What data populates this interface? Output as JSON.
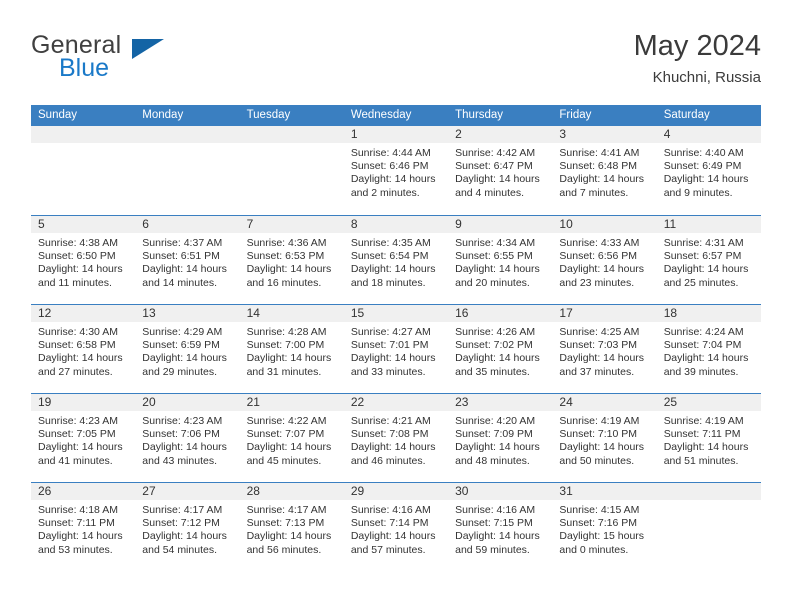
{
  "brand": {
    "line1": "General",
    "line2": "Blue",
    "triangle_color": "#1464a5",
    "blue_color": "#1a79c8"
  },
  "header": {
    "title": "May 2024",
    "subtitle": "Khuchni, Russia"
  },
  "theme": {
    "header_bg": "#3a7fc1",
    "header_text": "#ffffff",
    "daynum_bg": "#f0f0f0",
    "cell_bg": "#ffffff",
    "text": "#333333"
  },
  "weekdays": [
    "Sunday",
    "Monday",
    "Tuesday",
    "Wednesday",
    "Thursday",
    "Friday",
    "Saturday"
  ],
  "weeks": [
    [
      {
        "day": ""
      },
      {
        "day": ""
      },
      {
        "day": ""
      },
      {
        "day": "1",
        "sunrise": "Sunrise: 4:44 AM",
        "sunset": "Sunset: 6:46 PM",
        "daylight_1": "Daylight: 14 hours",
        "daylight_2": "and 2 minutes."
      },
      {
        "day": "2",
        "sunrise": "Sunrise: 4:42 AM",
        "sunset": "Sunset: 6:47 PM",
        "daylight_1": "Daylight: 14 hours",
        "daylight_2": "and 4 minutes."
      },
      {
        "day": "3",
        "sunrise": "Sunrise: 4:41 AM",
        "sunset": "Sunset: 6:48 PM",
        "daylight_1": "Daylight: 14 hours",
        "daylight_2": "and 7 minutes."
      },
      {
        "day": "4",
        "sunrise": "Sunrise: 4:40 AM",
        "sunset": "Sunset: 6:49 PM",
        "daylight_1": "Daylight: 14 hours",
        "daylight_2": "and 9 minutes."
      }
    ],
    [
      {
        "day": "5",
        "sunrise": "Sunrise: 4:38 AM",
        "sunset": "Sunset: 6:50 PM",
        "daylight_1": "Daylight: 14 hours",
        "daylight_2": "and 11 minutes."
      },
      {
        "day": "6",
        "sunrise": "Sunrise: 4:37 AM",
        "sunset": "Sunset: 6:51 PM",
        "daylight_1": "Daylight: 14 hours",
        "daylight_2": "and 14 minutes."
      },
      {
        "day": "7",
        "sunrise": "Sunrise: 4:36 AM",
        "sunset": "Sunset: 6:53 PM",
        "daylight_1": "Daylight: 14 hours",
        "daylight_2": "and 16 minutes."
      },
      {
        "day": "8",
        "sunrise": "Sunrise: 4:35 AM",
        "sunset": "Sunset: 6:54 PM",
        "daylight_1": "Daylight: 14 hours",
        "daylight_2": "and 18 minutes."
      },
      {
        "day": "9",
        "sunrise": "Sunrise: 4:34 AM",
        "sunset": "Sunset: 6:55 PM",
        "daylight_1": "Daylight: 14 hours",
        "daylight_2": "and 20 minutes."
      },
      {
        "day": "10",
        "sunrise": "Sunrise: 4:33 AM",
        "sunset": "Sunset: 6:56 PM",
        "daylight_1": "Daylight: 14 hours",
        "daylight_2": "and 23 minutes."
      },
      {
        "day": "11",
        "sunrise": "Sunrise: 4:31 AM",
        "sunset": "Sunset: 6:57 PM",
        "daylight_1": "Daylight: 14 hours",
        "daylight_2": "and 25 minutes."
      }
    ],
    [
      {
        "day": "12",
        "sunrise": "Sunrise: 4:30 AM",
        "sunset": "Sunset: 6:58 PM",
        "daylight_1": "Daylight: 14 hours",
        "daylight_2": "and 27 minutes."
      },
      {
        "day": "13",
        "sunrise": "Sunrise: 4:29 AM",
        "sunset": "Sunset: 6:59 PM",
        "daylight_1": "Daylight: 14 hours",
        "daylight_2": "and 29 minutes."
      },
      {
        "day": "14",
        "sunrise": "Sunrise: 4:28 AM",
        "sunset": "Sunset: 7:00 PM",
        "daylight_1": "Daylight: 14 hours",
        "daylight_2": "and 31 minutes."
      },
      {
        "day": "15",
        "sunrise": "Sunrise: 4:27 AM",
        "sunset": "Sunset: 7:01 PM",
        "daylight_1": "Daylight: 14 hours",
        "daylight_2": "and 33 minutes."
      },
      {
        "day": "16",
        "sunrise": "Sunrise: 4:26 AM",
        "sunset": "Sunset: 7:02 PM",
        "daylight_1": "Daylight: 14 hours",
        "daylight_2": "and 35 minutes."
      },
      {
        "day": "17",
        "sunrise": "Sunrise: 4:25 AM",
        "sunset": "Sunset: 7:03 PM",
        "daylight_1": "Daylight: 14 hours",
        "daylight_2": "and 37 minutes."
      },
      {
        "day": "18",
        "sunrise": "Sunrise: 4:24 AM",
        "sunset": "Sunset: 7:04 PM",
        "daylight_1": "Daylight: 14 hours",
        "daylight_2": "and 39 minutes."
      }
    ],
    [
      {
        "day": "19",
        "sunrise": "Sunrise: 4:23 AM",
        "sunset": "Sunset: 7:05 PM",
        "daylight_1": "Daylight: 14 hours",
        "daylight_2": "and 41 minutes."
      },
      {
        "day": "20",
        "sunrise": "Sunrise: 4:23 AM",
        "sunset": "Sunset: 7:06 PM",
        "daylight_1": "Daylight: 14 hours",
        "daylight_2": "and 43 minutes."
      },
      {
        "day": "21",
        "sunrise": "Sunrise: 4:22 AM",
        "sunset": "Sunset: 7:07 PM",
        "daylight_1": "Daylight: 14 hours",
        "daylight_2": "and 45 minutes."
      },
      {
        "day": "22",
        "sunrise": "Sunrise: 4:21 AM",
        "sunset": "Sunset: 7:08 PM",
        "daylight_1": "Daylight: 14 hours",
        "daylight_2": "and 46 minutes."
      },
      {
        "day": "23",
        "sunrise": "Sunrise: 4:20 AM",
        "sunset": "Sunset: 7:09 PM",
        "daylight_1": "Daylight: 14 hours",
        "daylight_2": "and 48 minutes."
      },
      {
        "day": "24",
        "sunrise": "Sunrise: 4:19 AM",
        "sunset": "Sunset: 7:10 PM",
        "daylight_1": "Daylight: 14 hours",
        "daylight_2": "and 50 minutes."
      },
      {
        "day": "25",
        "sunrise": "Sunrise: 4:19 AM",
        "sunset": "Sunset: 7:11 PM",
        "daylight_1": "Daylight: 14 hours",
        "daylight_2": "and 51 minutes."
      }
    ],
    [
      {
        "day": "26",
        "sunrise": "Sunrise: 4:18 AM",
        "sunset": "Sunset: 7:11 PM",
        "daylight_1": "Daylight: 14 hours",
        "daylight_2": "and 53 minutes."
      },
      {
        "day": "27",
        "sunrise": "Sunrise: 4:17 AM",
        "sunset": "Sunset: 7:12 PM",
        "daylight_1": "Daylight: 14 hours",
        "daylight_2": "and 54 minutes."
      },
      {
        "day": "28",
        "sunrise": "Sunrise: 4:17 AM",
        "sunset": "Sunset: 7:13 PM",
        "daylight_1": "Daylight: 14 hours",
        "daylight_2": "and 56 minutes."
      },
      {
        "day": "29",
        "sunrise": "Sunrise: 4:16 AM",
        "sunset": "Sunset: 7:14 PM",
        "daylight_1": "Daylight: 14 hours",
        "daylight_2": "and 57 minutes."
      },
      {
        "day": "30",
        "sunrise": "Sunrise: 4:16 AM",
        "sunset": "Sunset: 7:15 PM",
        "daylight_1": "Daylight: 14 hours",
        "daylight_2": "and 59 minutes."
      },
      {
        "day": "31",
        "sunrise": "Sunrise: 4:15 AM",
        "sunset": "Sunset: 7:16 PM",
        "daylight_1": "Daylight: 15 hours",
        "daylight_2": "and 0 minutes."
      },
      {
        "day": ""
      }
    ]
  ]
}
